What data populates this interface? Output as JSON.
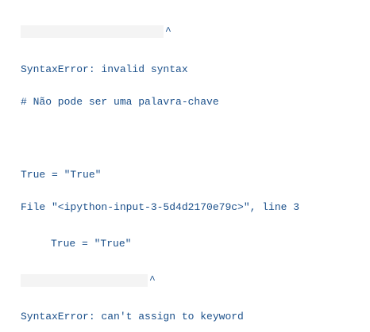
{
  "output": {
    "caret": "^",
    "error1": "SyntaxError: invalid syntax",
    "comment": "# Não pode ser uma palavra-chave",
    "code": "True = \"True\"",
    "file_line": "File \"<ipython-input-3-5d4d2170e79c>\", line 3",
    "code_indented": "True = \"True\"",
    "error2": "SyntaxError: can't assign to keyword"
  }
}
